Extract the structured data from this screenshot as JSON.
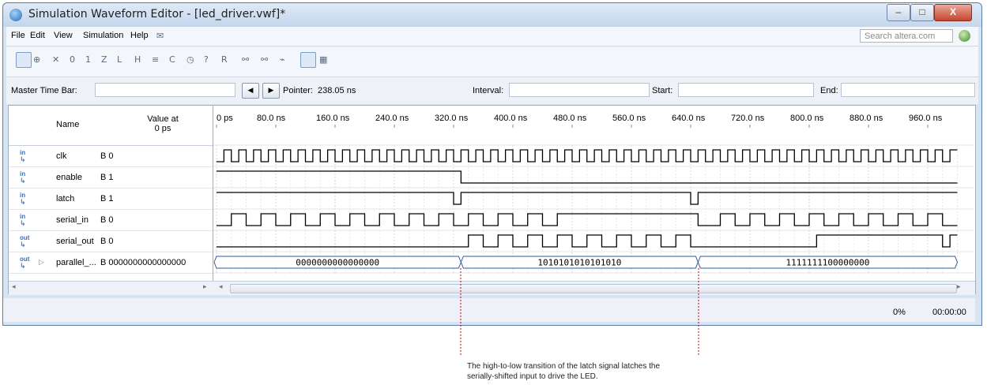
{
  "window": {
    "title": "Simulation Waveform Editor - [led_driver.vwf]*",
    "minimize": "–",
    "maximize": "□",
    "close": "X"
  },
  "menu": {
    "items": [
      "File",
      "Edit",
      "View",
      "Simulation",
      "Help"
    ],
    "search_placeholder": "Search altera.com"
  },
  "controls": {
    "master_time_bar_label": "Master Time Bar:",
    "master_time_bar_value": "",
    "pointer_label": "Pointer:",
    "pointer_value": "238.05 ns",
    "interval_label": "Interval:",
    "interval_value": "",
    "start_label": "Start:",
    "start_value": "",
    "end_label": "End:",
    "end_value": ""
  },
  "table": {
    "name_header": "Name",
    "value_header_line1": "Value at",
    "value_header_line2": "0 ps",
    "time_ticks": [
      "0 ps",
      "80.0 ns",
      "160.0 ns",
      "240.0 ns",
      "320.0 ns",
      "400.0 ns",
      "480.0 ns",
      "560.0 ns",
      "640.0 ns",
      "720.0 ns",
      "800.0 ns",
      "880.0 ns",
      "960.0 ns"
    ],
    "signals": [
      {
        "dir": "in",
        "name": "clk",
        "value": "B 0"
      },
      {
        "dir": "in",
        "name": "enable",
        "value": "B 1"
      },
      {
        "dir": "in",
        "name": "latch",
        "value": "B 1"
      },
      {
        "dir": "in",
        "name": "serial_in",
        "value": "B 0"
      },
      {
        "dir": "out",
        "name": "serial_out",
        "value": "B 0"
      },
      {
        "dir": "out",
        "name": "parallel_...",
        "value": "B 0000000000000000"
      }
    ],
    "bus_segments": [
      "0000000000000000",
      "1010101010101010",
      "1111111100000000"
    ]
  },
  "status": {
    "progress": "0%",
    "elapsed": "00:00:00"
  },
  "annotation": {
    "line1": "The high-to-low transition of the latch signal latches the",
    "line2": "serially-shifted input to drive the LED."
  },
  "colors": {
    "wave": "#000000",
    "annotation_line": "#c00000"
  }
}
